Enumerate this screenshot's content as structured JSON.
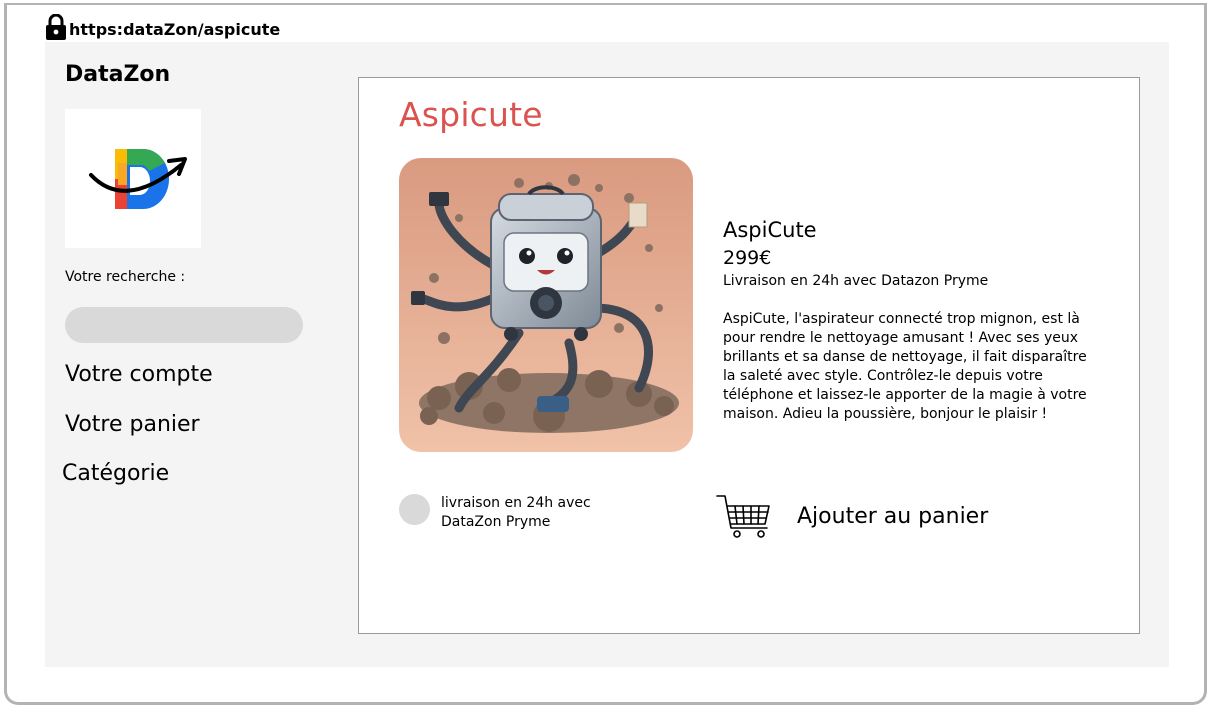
{
  "browser": {
    "url": "https:dataZon/aspicute",
    "lock_icon": "lock-icon"
  },
  "sidebar": {
    "brand": "DataZon",
    "logo_icon": "datazon-logo",
    "search_label": "Votre recherche :",
    "search_value": "",
    "links": {
      "account": "Votre compte",
      "cart": "Votre panier",
      "category": "Catégorie"
    }
  },
  "product": {
    "title": "Aspicute",
    "name": "AspiCute",
    "price": "299€",
    "delivery": "Livraison en 24h avec Datazon Pryme",
    "description": "AspiCute, l'aspirateur connecté trop mignon, est là pour rendre le  nettoyage amusant ! Avec ses yeux brillants et sa danse de nettoyage, il  fait disparaître la saleté avec style. Contrôlez-le depuis votre  téléphone et laissez-le apporter de la magie à votre maison.  Adieu la poussière, bonjour le plaisir !",
    "delivery_option": "livraison en 24h avec DataZon Pryme",
    "add_to_cart": "Ajouter au panier",
    "cart_icon": "shopping-cart-icon",
    "image_icon": "vacuum-robot-image"
  },
  "colors": {
    "title_accent": "#d9534f",
    "page_bg": "#f4f4f4",
    "input_bg": "#d9d9d9"
  }
}
